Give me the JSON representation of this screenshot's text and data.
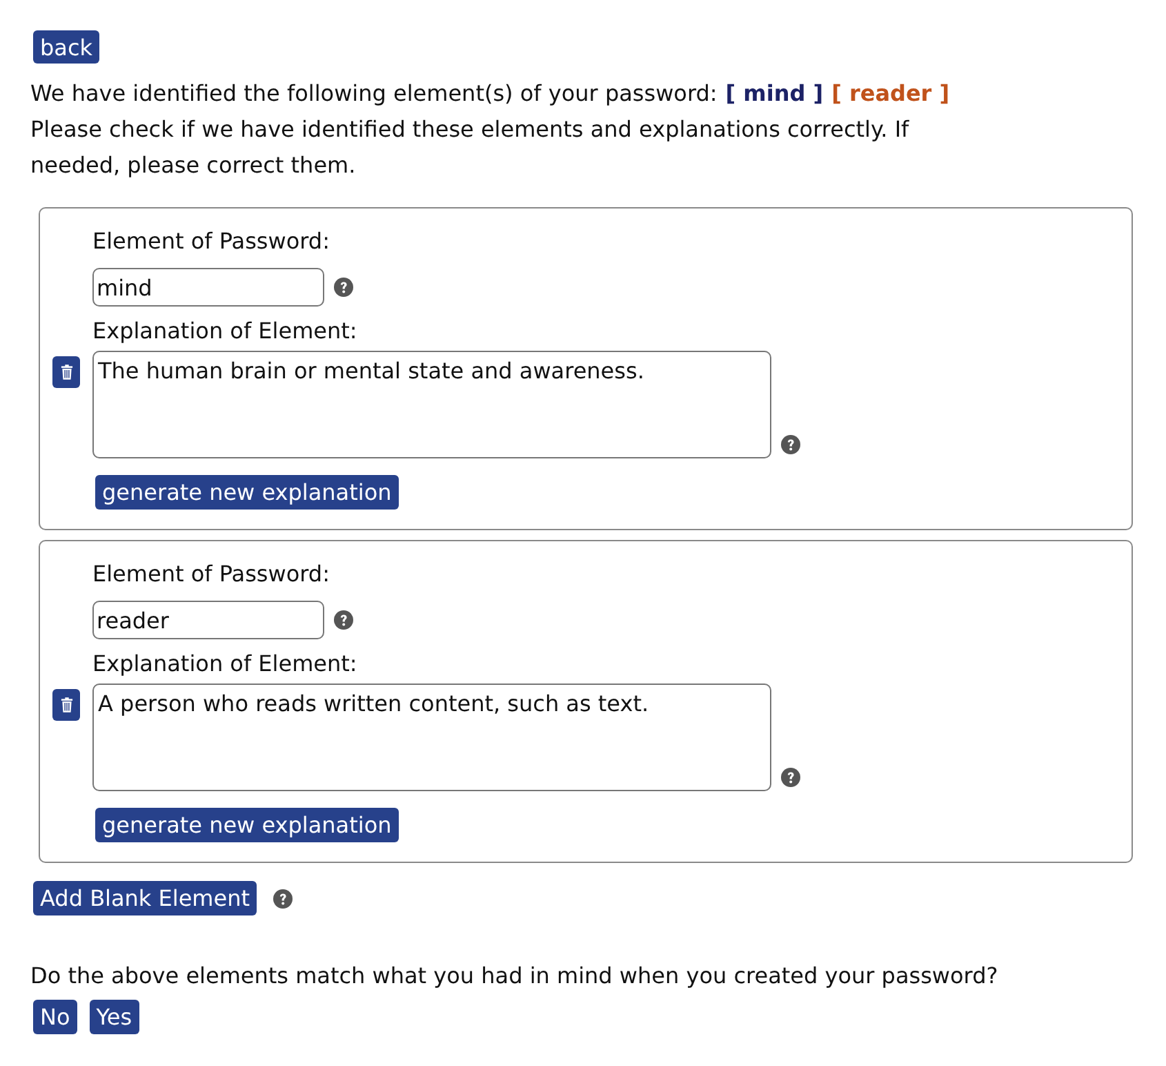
{
  "back_button": "back",
  "intro": {
    "text": "We have identified the following element(s) of your password:",
    "elements": [
      {
        "text": "[ mind ]",
        "color": "#1c2266"
      },
      {
        "text": "[ reader ]",
        "color": "#c0521b"
      }
    ]
  },
  "instructions": "Please check if we have identified these elements and explanations correctly. If needed, please correct them.",
  "element_cards": [
    {
      "element_label": "Element of Password:",
      "element_value": "mind",
      "explanation_label": "Explanation of Element:",
      "explanation_value": "The human brain or mental state and awareness.",
      "generate_button": "generate new explanation"
    },
    {
      "element_label": "Element of Password:",
      "element_value": "reader",
      "explanation_label": "Explanation of Element:",
      "explanation_value": "A person who reads written content, such as text.",
      "generate_button": "generate new explanation"
    }
  ],
  "add_button": "Add Blank Element",
  "question": "Do the above elements match what you had in mind when you created your password?",
  "answer_buttons": [
    "No",
    "Yes"
  ]
}
